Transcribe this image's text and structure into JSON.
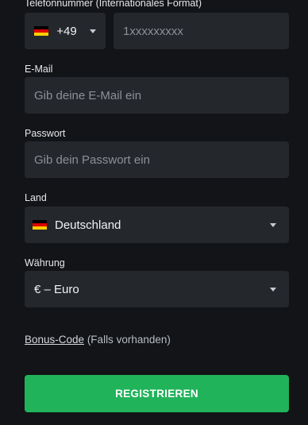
{
  "phone": {
    "label": "Telefonnummer (Internationales Format)",
    "country_code": "+49",
    "flag_icon": "flag-de-icon",
    "placeholder": "1xxxxxxxxx"
  },
  "email": {
    "label": "E-Mail",
    "placeholder": "Gib deine E-Mail ein"
  },
  "password": {
    "label": "Passwort",
    "placeholder": "Gib dein Passwort ein"
  },
  "country": {
    "label": "Land",
    "value": "Deutschland",
    "flag_icon": "flag-de-icon"
  },
  "currency": {
    "label": "Währung",
    "value": "€ – Euro"
  },
  "bonus": {
    "link_text": "Bonus-Code",
    "suffix": " (Falls vorhanden)"
  },
  "submit": {
    "label": "REGISTRIEREN"
  },
  "colors": {
    "background": "#121417",
    "field": "#24272c",
    "accent": "#21b35a"
  }
}
